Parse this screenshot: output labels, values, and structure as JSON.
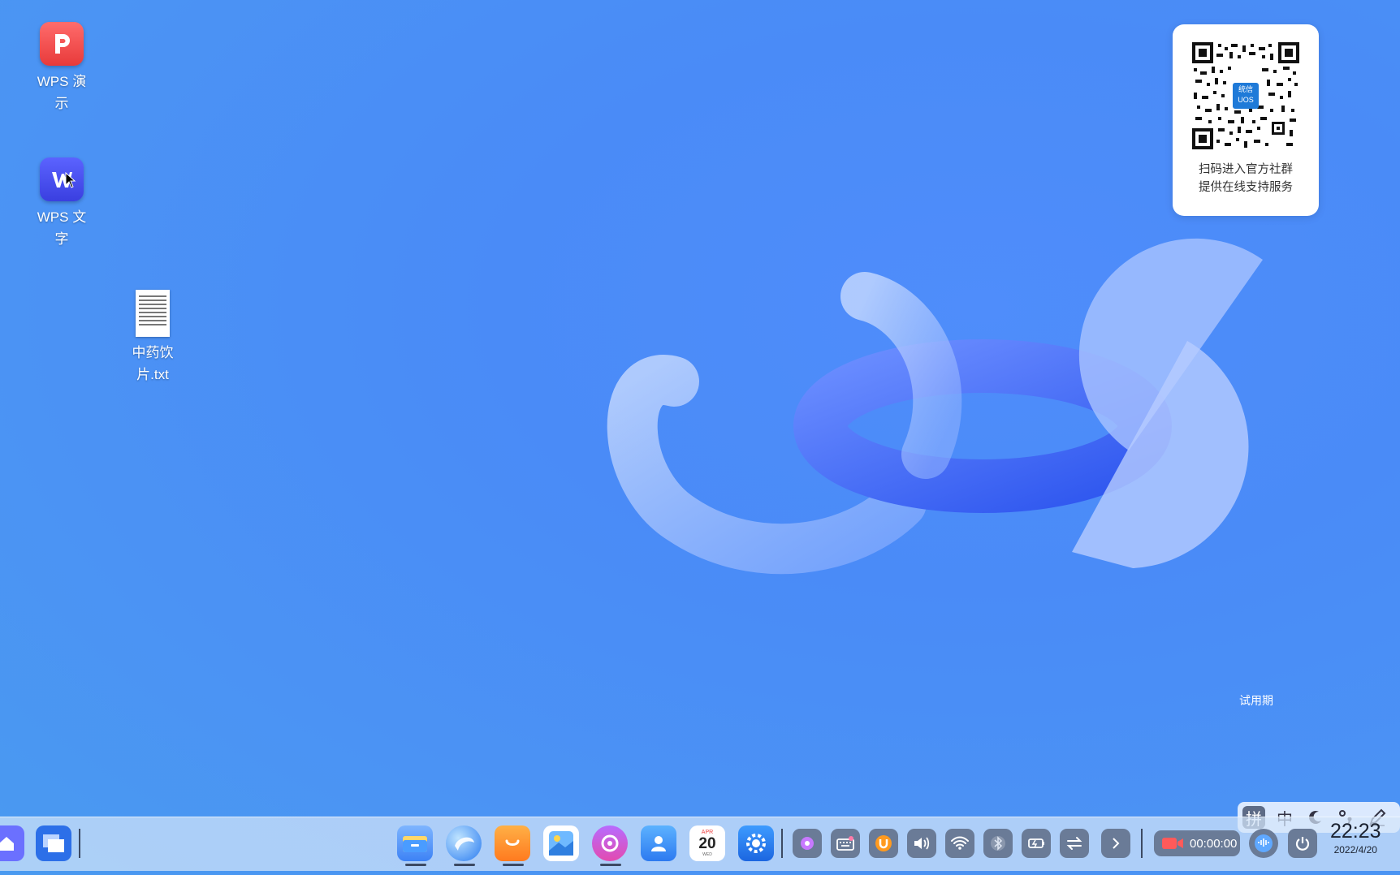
{
  "desktop": {
    "icons": [
      {
        "label": "WPS 演示",
        "line1": "WPS 演",
        "line2": "示"
      },
      {
        "label": "WPS 文字",
        "line1": "WPS 文",
        "line2": "字"
      },
      {
        "label": "中药饮片.txt",
        "line1": "中药饮",
        "line2": "片.txt"
      }
    ],
    "qr_card": {
      "logo": "统信 UOS",
      "line1": "扫码进入官方社群",
      "line2": "提供在线支持服务"
    },
    "trial_label": "试用期"
  },
  "ime_toolbar": {
    "pinyin": "拼",
    "chinese": "中"
  },
  "dock": {
    "apps": [
      "launcher",
      "multitask-view",
      "file-manager",
      "browser",
      "app-store",
      "image-viewer",
      "music",
      "contacts",
      "calendar",
      "control-center"
    ],
    "calendar": {
      "month": "APR",
      "day": "20",
      "weekday": "WED"
    },
    "recorder_time": "00:00:00",
    "clock_time": "22:23",
    "clock_date": "2022/4/20"
  },
  "colors": {
    "wallpaper": "#4a8bf7",
    "dock": "#d2e4fa",
    "ppt": "#e83a3a",
    "word": "#3a3fe0"
  }
}
